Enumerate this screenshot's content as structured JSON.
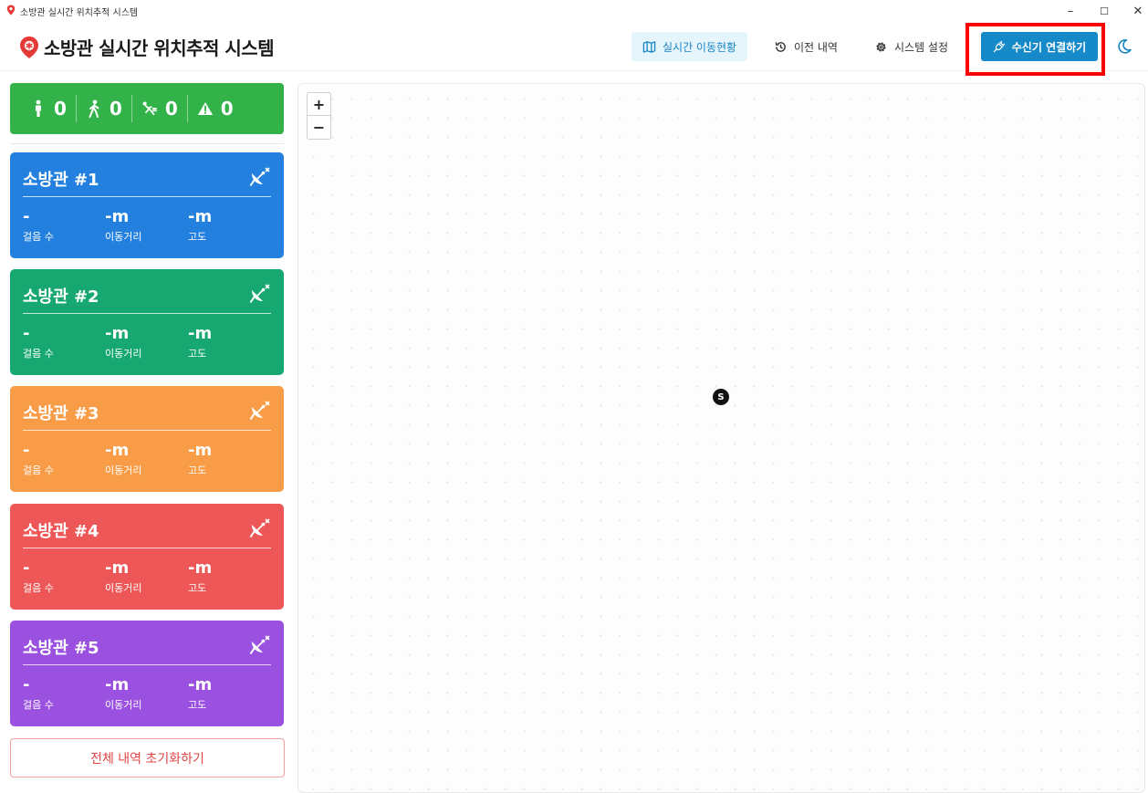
{
  "window": {
    "title": "소방관 실시간 위치추적 시스템",
    "minimize": "–",
    "maximize": "☐",
    "close": "✕"
  },
  "header": {
    "app_title": "소방관 실시간 위치추적 시스템",
    "nav": [
      {
        "label": "실시간 이동현황",
        "icon": "map-icon",
        "active": true
      },
      {
        "label": "이전 내역",
        "icon": "history-icon",
        "active": false
      },
      {
        "label": "시스템 설정",
        "icon": "gear-icon",
        "active": false
      }
    ],
    "connect_label": "수신기 연결하기",
    "connect_icon": "plug-icon",
    "theme_icon": "moon-icon"
  },
  "summary": {
    "standing": "0",
    "walking": "0",
    "fallen": "0",
    "alert": "0"
  },
  "firefighters": [
    {
      "name": "소방관 #1",
      "color": "#2380de",
      "steps": "-",
      "distance": "-m",
      "altitude": "-m"
    },
    {
      "name": "소방관 #2",
      "color": "#17a872",
      "steps": "-",
      "distance": "-m",
      "altitude": "-m"
    },
    {
      "name": "소방관 #3",
      "color": "#f99c48",
      "steps": "-",
      "distance": "-m",
      "altitude": "-m"
    },
    {
      "name": "소방관 #4",
      "color": "#ee5757",
      "steps": "-",
      "distance": "-m",
      "altitude": "-m"
    },
    {
      "name": "소방관 #5",
      "color": "#9b51e0",
      "steps": "-",
      "distance": "-m",
      "altitude": "-m"
    }
  ],
  "labels": {
    "steps": "걸음 수",
    "distance": "이동거리",
    "altitude": "고도"
  },
  "reset_label": "전체 내역 초기화하기",
  "map": {
    "zoom_in": "+",
    "zoom_out": "−",
    "start_marker": "S"
  },
  "colors": {
    "summary": "#33b249",
    "primary": "#168ac8",
    "danger": "#e04545"
  }
}
